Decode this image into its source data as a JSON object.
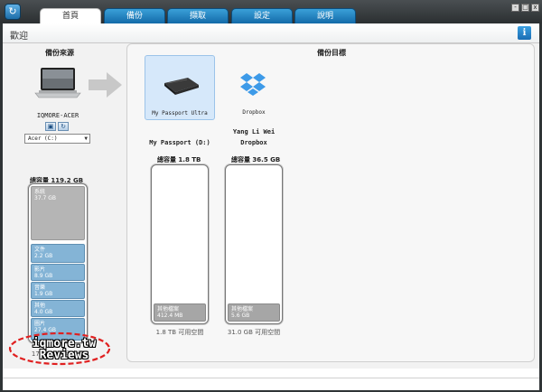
{
  "tabs": [
    {
      "label": "首頁",
      "active": true
    },
    {
      "label": "備份",
      "active": false
    },
    {
      "label": "擷取",
      "active": false
    },
    {
      "label": "設定",
      "active": false
    },
    {
      "label": "說明",
      "active": false
    }
  ],
  "window_controls": {
    "minimize": "-",
    "maximize": "□",
    "close": "x"
  },
  "header": {
    "title": "歡迎",
    "info_icon": "i"
  },
  "source": {
    "label": "備份來源",
    "device_name": "IQMORE-ACER",
    "drive_value": "Acer (C:)",
    "capacity": "總容量 119.2 GB",
    "segments": [
      {
        "name": "系統",
        "size": "37.7 GB"
      },
      {
        "name": "文件",
        "size": "2.2 GB"
      },
      {
        "name": "影片",
        "size": "8.9 GB"
      },
      {
        "name": "音樂",
        "size": "1.9 GB"
      },
      {
        "name": "其他",
        "size": "4.0 GB"
      },
      {
        "name": "圖片",
        "size": "27.4 GB"
      }
    ],
    "free": "17.5 GB 可用空間"
  },
  "target": {
    "label": "備份目標",
    "devices": [
      {
        "name": "My Passport Ultra",
        "selected": true
      },
      {
        "name": "Dropbox",
        "selected": false
      }
    ],
    "dropbox_user": "Yang Li Wei",
    "drives": [
      {
        "title": "My Passport (D:)",
        "capacity": "總容量 1.8 TB",
        "segment_name": "其他檔案",
        "segment_size": "412.4 MB",
        "free": "1.8 TB 可用空間"
      },
      {
        "title": "Dropbox",
        "capacity": "總容量 36.5 GB",
        "segment_name": "其他檔案",
        "segment_size": "5.6 GB",
        "free": "31.0 GB 可用空間"
      }
    ]
  },
  "watermark": {
    "line1": "iqmore.tw",
    "line2": "Reviews"
  },
  "colors": {
    "tab_blue": "#1f7fc1",
    "segment_blue": "#84b4d6",
    "selected_card": "#d6e8fa"
  }
}
